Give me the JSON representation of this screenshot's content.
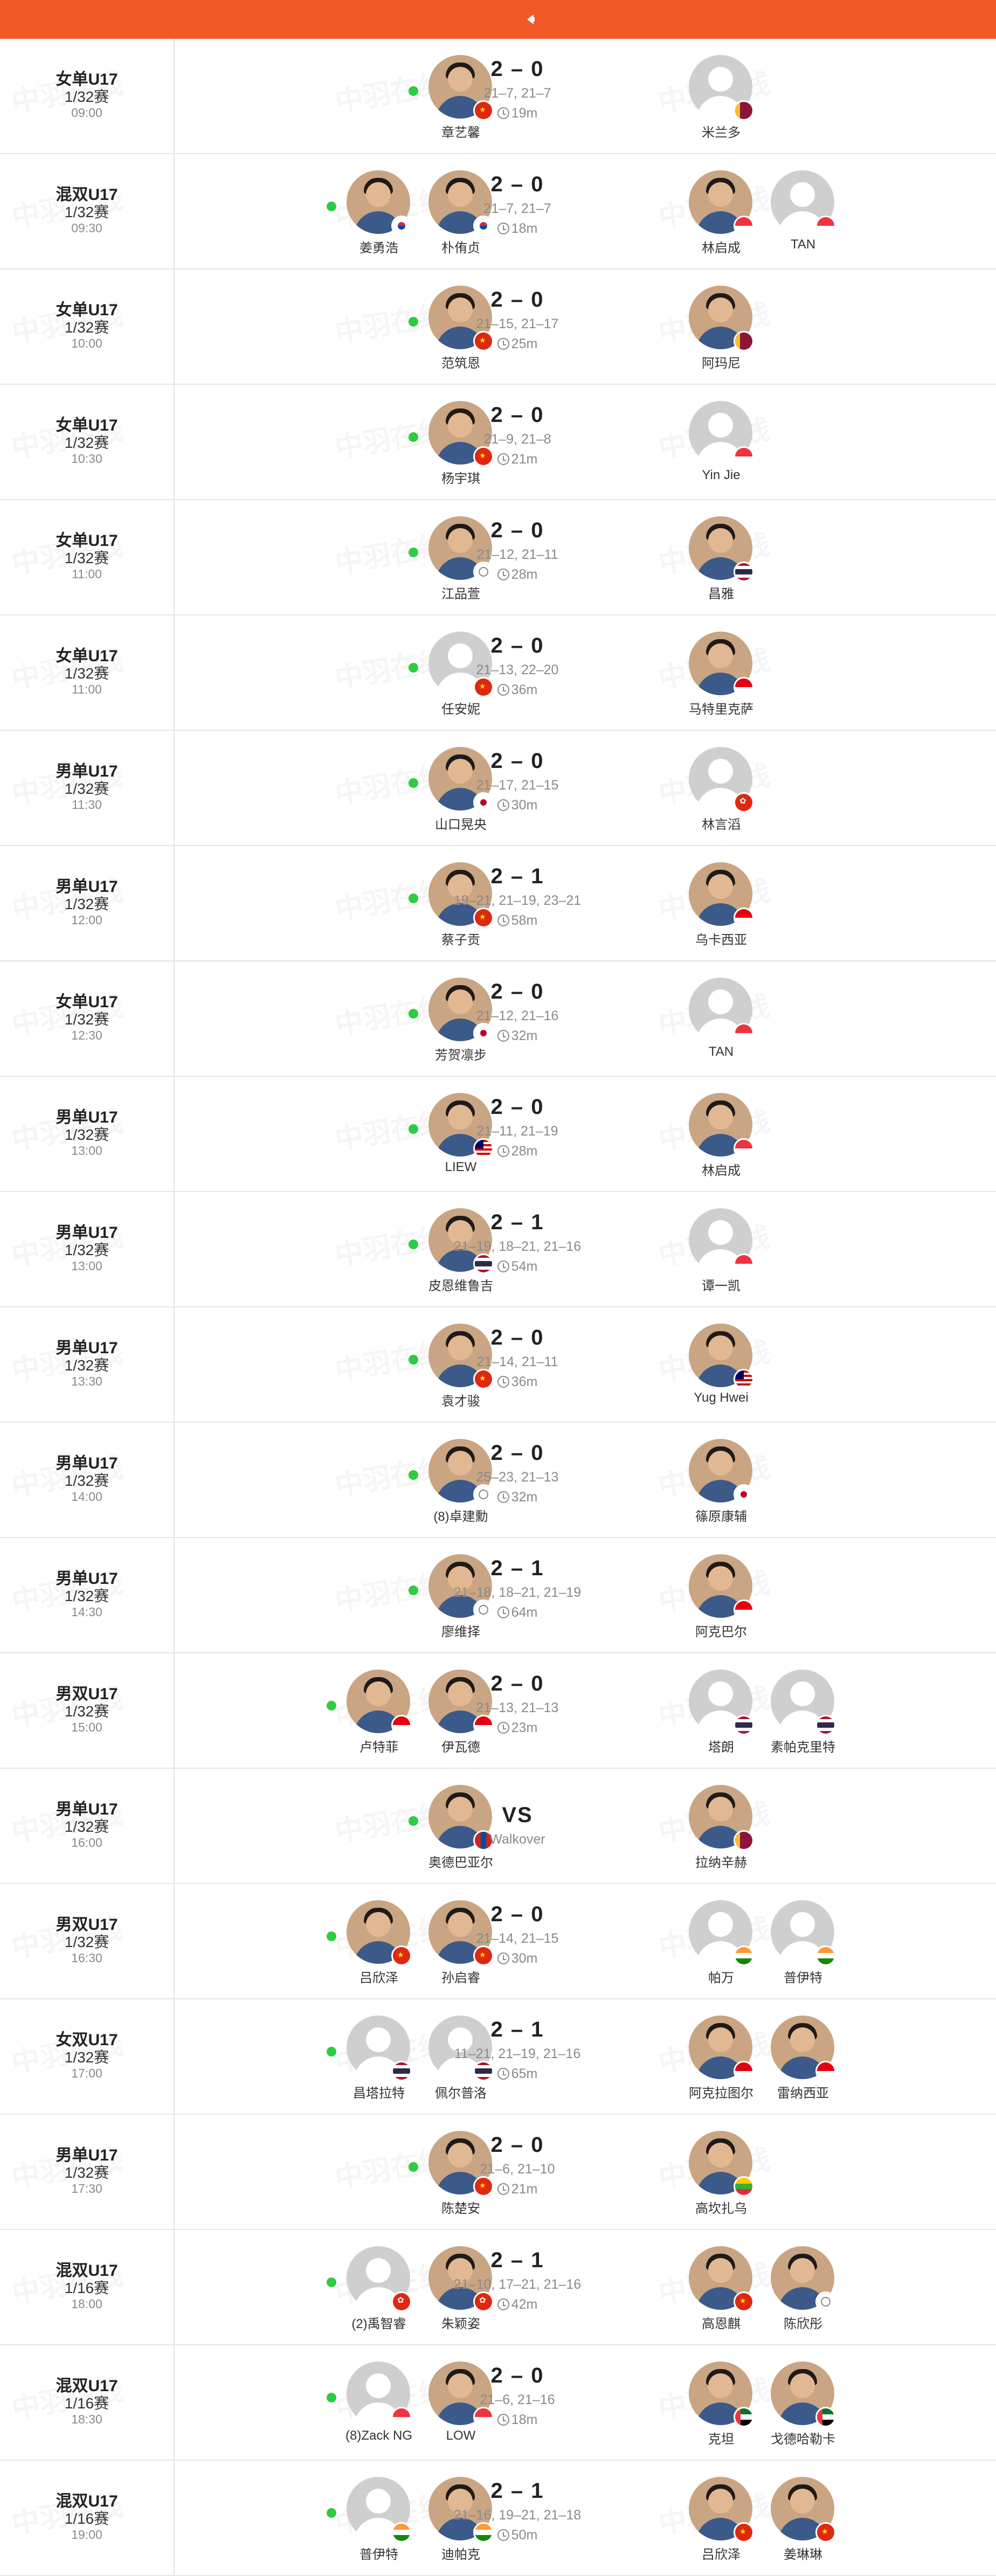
{
  "header": {
    "back_icon": "back-arrow-icon",
    "color": "#f05a28"
  },
  "watermark": "中羽在线",
  "colors": {
    "win_dot": "#2ecc40",
    "accent": "#f05a28"
  },
  "matches": [
    {
      "event": "女单U17",
      "round": "1/32赛",
      "time": "09:00",
      "score": "2 – 0",
      "games": "21–7, 21–7",
      "duration": "19m",
      "left": [
        {
          "name": "章艺馨",
          "flag": "cn",
          "photo": true
        }
      ],
      "right": [
        {
          "name": "米兰多",
          "flag": "lk",
          "photo": false
        }
      ],
      "winner": "left"
    },
    {
      "event": "混双U17",
      "round": "1/32赛",
      "time": "09:30",
      "score": "2 – 0",
      "games": "21–7, 21–7",
      "duration": "18m",
      "left": [
        {
          "name": "姜勇浩",
          "flag": "kr",
          "photo": true
        },
        {
          "name": "朴侑贞",
          "flag": "kr",
          "photo": true
        }
      ],
      "right": [
        {
          "name": "林启成",
          "flag": "sg",
          "photo": true
        },
        {
          "name": "TAN",
          "flag": "sg",
          "photo": false
        }
      ],
      "winner": "left"
    },
    {
      "event": "女单U17",
      "round": "1/32赛",
      "time": "10:00",
      "score": "2 – 0",
      "games": "21–15, 21–17",
      "duration": "25m",
      "left": [
        {
          "name": "范筑恩",
          "flag": "cn",
          "photo": true
        }
      ],
      "right": [
        {
          "name": "阿玛尼",
          "flag": "lk",
          "photo": true
        }
      ],
      "winner": "left"
    },
    {
      "event": "女单U17",
      "round": "1/32赛",
      "time": "10:30",
      "score": "2 – 0",
      "games": "21–9, 21–8",
      "duration": "21m",
      "left": [
        {
          "name": "杨宇琪",
          "flag": "cn",
          "photo": true
        }
      ],
      "right": [
        {
          "name": "Yin Jie",
          "flag": "sg",
          "photo": false
        }
      ],
      "winner": "left"
    },
    {
      "event": "女单U17",
      "round": "1/32赛",
      "time": "11:00",
      "score": "2 – 0",
      "games": "21–12, 21–11",
      "duration": "28m",
      "left": [
        {
          "name": "江品萱",
          "flag": "tpe",
          "photo": true
        }
      ],
      "right": [
        {
          "name": "昌雅",
          "flag": "th",
          "photo": true
        }
      ],
      "winner": "left"
    },
    {
      "event": "女单U17",
      "round": "1/32赛",
      "time": "11:00",
      "score": "2 – 0",
      "games": "21–13, 22–20",
      "duration": "36m",
      "left": [
        {
          "name": "任安妮",
          "flag": "cn",
          "photo": false
        }
      ],
      "right": [
        {
          "name": "马特里克萨",
          "flag": "id",
          "photo": true
        }
      ],
      "winner": "left"
    },
    {
      "event": "男单U17",
      "round": "1/32赛",
      "time": "11:30",
      "score": "2 – 0",
      "games": "21–17, 21–15",
      "duration": "30m",
      "left": [
        {
          "name": "山口晃央",
          "flag": "jp",
          "photo": true
        }
      ],
      "right": [
        {
          "name": "林言滔",
          "flag": "hk",
          "photo": false
        }
      ],
      "winner": "left"
    },
    {
      "event": "男单U17",
      "round": "1/32赛",
      "time": "12:00",
      "score": "2 – 1",
      "games": "19–21, 21–19, 23–21",
      "duration": "58m",
      "left": [
        {
          "name": "蔡子贡",
          "flag": "cn",
          "photo": true
        }
      ],
      "right": [
        {
          "name": "乌卡西亚",
          "flag": "id",
          "photo": true
        }
      ],
      "winner": "left"
    },
    {
      "event": "女单U17",
      "round": "1/32赛",
      "time": "12:30",
      "score": "2 – 0",
      "games": "21–12, 21–16",
      "duration": "32m",
      "left": [
        {
          "name": "芳贺凛步",
          "flag": "jp",
          "photo": true
        }
      ],
      "right": [
        {
          "name": "TAN",
          "flag": "sg",
          "photo": false
        }
      ],
      "winner": "left"
    },
    {
      "event": "男单U17",
      "round": "1/32赛",
      "time": "13:00",
      "score": "2 – 0",
      "games": "21–11, 21–19",
      "duration": "28m",
      "left": [
        {
          "name": "LIEW",
          "flag": "my",
          "photo": true
        }
      ],
      "right": [
        {
          "name": "林启成",
          "flag": "sg",
          "photo": true
        }
      ],
      "winner": "left"
    },
    {
      "event": "男单U17",
      "round": "1/32赛",
      "time": "13:00",
      "score": "2 – 1",
      "games": "21–19, 18–21, 21–16",
      "duration": "54m",
      "left": [
        {
          "name": "皮恩维鲁吉",
          "flag": "th",
          "photo": true
        }
      ],
      "right": [
        {
          "name": "谭一凯",
          "flag": "sg",
          "photo": false
        }
      ],
      "winner": "left"
    },
    {
      "event": "男单U17",
      "round": "1/32赛",
      "time": "13:30",
      "score": "2 – 0",
      "games": "21–14, 21–11",
      "duration": "36m",
      "left": [
        {
          "name": "袁才骏",
          "flag": "cn",
          "photo": true
        }
      ],
      "right": [
        {
          "name": "Yug Hwei",
          "flag": "my",
          "photo": true
        }
      ],
      "winner": "left"
    },
    {
      "event": "男单U17",
      "round": "1/32赛",
      "time": "14:00",
      "score": "2 – 0",
      "games": "25–23, 21–13",
      "duration": "32m",
      "left": [
        {
          "name": "(8)卓建勳",
          "flag": "tpe",
          "photo": true
        }
      ],
      "right": [
        {
          "name": "篠原康辅",
          "flag": "jp",
          "photo": true
        }
      ],
      "winner": "left"
    },
    {
      "event": "男单U17",
      "round": "1/32赛",
      "time": "14:30",
      "score": "2 – 1",
      "games": "21–18, 18–21, 21–19",
      "duration": "64m",
      "left": [
        {
          "name": "廖维择",
          "flag": "tpe",
          "photo": true
        }
      ],
      "right": [
        {
          "name": "阿克巴尔",
          "flag": "id",
          "photo": true
        }
      ],
      "winner": "left"
    },
    {
      "event": "男双U17",
      "round": "1/32赛",
      "time": "15:00",
      "score": "2 – 0",
      "games": "21–13, 21–13",
      "duration": "23m",
      "left": [
        {
          "name": "卢特菲",
          "flag": "id",
          "photo": true
        },
        {
          "name": "伊瓦德",
          "flag": "id",
          "photo": true
        }
      ],
      "right": [
        {
          "name": "塔朗",
          "flag": "th",
          "photo": false
        },
        {
          "name": "素帕克里特",
          "flag": "th",
          "photo": false
        }
      ],
      "winner": "left"
    },
    {
      "event": "男单U17",
      "round": "1/32赛",
      "time": "16:00",
      "score": "VS",
      "games": "Walkover",
      "duration": "",
      "left": [
        {
          "name": "奥德巴亚尔",
          "flag": "mn",
          "photo": true
        }
      ],
      "right": [
        {
          "name": "拉纳辛赫",
          "flag": "lk",
          "photo": true
        }
      ],
      "winner": "left"
    },
    {
      "event": "男双U17",
      "round": "1/32赛",
      "time": "16:30",
      "score": "2 – 0",
      "games": "21–14, 21–15",
      "duration": "30m",
      "left": [
        {
          "name": "吕欣泽",
          "flag": "cn",
          "photo": true
        },
        {
          "name": "孙启睿",
          "flag": "cn",
          "photo": true
        }
      ],
      "right": [
        {
          "name": "帕万",
          "flag": "in",
          "photo": false
        },
        {
          "name": "普伊特",
          "flag": "in",
          "photo": false
        }
      ],
      "winner": "left"
    },
    {
      "event": "女双U17",
      "round": "1/32赛",
      "time": "17:00",
      "score": "2 – 1",
      "games": "11–21, 21–19, 21–16",
      "duration": "65m",
      "left": [
        {
          "name": "昌塔拉特",
          "flag": "th",
          "photo": false
        },
        {
          "name": "佩尔普洛",
          "flag": "th",
          "photo": false
        }
      ],
      "right": [
        {
          "name": "阿克拉图尔",
          "flag": "id",
          "photo": true
        },
        {
          "name": "雷纳西亚",
          "flag": "id",
          "photo": true
        }
      ],
      "winner": "left"
    },
    {
      "event": "男单U17",
      "round": "1/32赛",
      "time": "17:30",
      "score": "2 – 0",
      "games": "21–6, 21–10",
      "duration": "21m",
      "left": [
        {
          "name": "陈楚安",
          "flag": "cn",
          "photo": true
        }
      ],
      "right": [
        {
          "name": "高坎扎乌",
          "flag": "mm",
          "photo": true
        }
      ],
      "winner": "left"
    },
    {
      "event": "混双U17",
      "round": "1/16赛",
      "time": "18:00",
      "score": "2 – 1",
      "games": "21–10, 17–21, 21–16",
      "duration": "42m",
      "left": [
        {
          "name": "(2)禹智睿",
          "flag": "hk",
          "photo": false
        },
        {
          "name": "朱颖姿",
          "flag": "hk",
          "photo": true
        }
      ],
      "right": [
        {
          "name": "高恩麒",
          "flag": "cn",
          "photo": true
        },
        {
          "name": "陈欣彤",
          "flag": "tpe",
          "photo": true
        }
      ],
      "winner": "left"
    },
    {
      "event": "混双U17",
      "round": "1/16赛",
      "time": "18:30",
      "score": "2 – 0",
      "games": "21–6, 21–16",
      "duration": "18m",
      "left": [
        {
          "name": "(8)Zack NG",
          "flag": "sg",
          "photo": false
        },
        {
          "name": "LOW",
          "flag": "sg",
          "photo": true
        }
      ],
      "right": [
        {
          "name": "克坦",
          "flag": "ae",
          "photo": true
        },
        {
          "name": "戈德哈勒卡",
          "flag": "ae",
          "photo": true
        }
      ],
      "winner": "left"
    },
    {
      "event": "混双U17",
      "round": "1/16赛",
      "time": "19:00",
      "score": "2 – 1",
      "games": "21–16, 19–21, 21–18",
      "duration": "50m",
      "left": [
        {
          "name": "普伊特",
          "flag": "in",
          "photo": false
        },
        {
          "name": "迪帕克",
          "flag": "in",
          "photo": true
        }
      ],
      "right": [
        {
          "name": "吕欣泽",
          "flag": "cn",
          "photo": true
        },
        {
          "name": "姜琳琳",
          "flag": "cn",
          "photo": true
        }
      ],
      "winner": "left"
    }
  ]
}
